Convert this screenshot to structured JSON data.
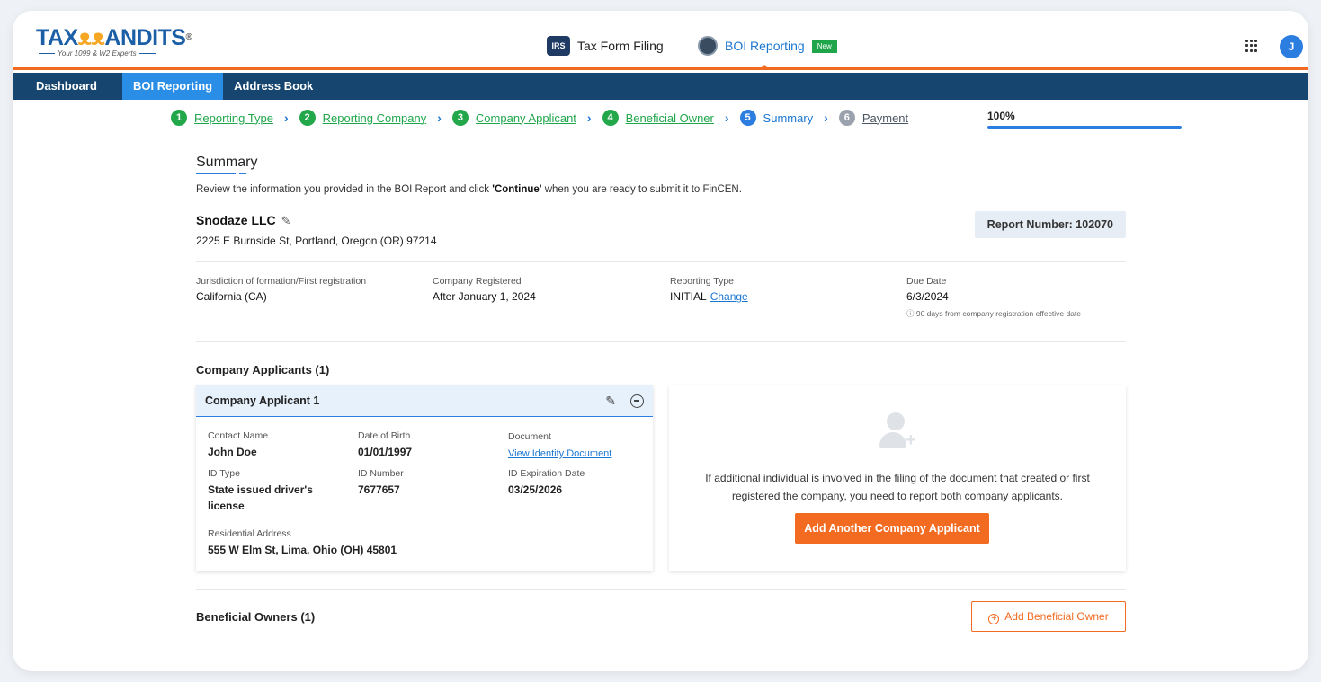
{
  "brand": {
    "name_part1": "TAX",
    "name_owl": "ᴥᴥ",
    "name_part2": "ANDITS",
    "registered": "®",
    "tagline": "Your 1099 & W2 Experts"
  },
  "header": {
    "tax_form_filing": "Tax Form Filing",
    "boi_reporting": "BOI Reporting",
    "new_badge": "New",
    "avatar_initial": "J"
  },
  "nav": {
    "items": [
      {
        "label": "Dashboard"
      },
      {
        "label": "BOI Reporting"
      },
      {
        "label": "Address Book"
      }
    ]
  },
  "stepper": {
    "steps": [
      {
        "num": "1",
        "label": "Reporting Type"
      },
      {
        "num": "2",
        "label": "Reporting Company"
      },
      {
        "num": "3",
        "label": "Company Applicant"
      },
      {
        "num": "4",
        "label": "Beneficial Owner"
      },
      {
        "num": "5",
        "label": "Summary"
      },
      {
        "num": "6",
        "label": "Payment"
      }
    ],
    "progress_label": "100%",
    "progress_fraction": 1.0
  },
  "summary": {
    "title": "Summary",
    "review_prefix": "Review the information you provided in the BOI Report and click ",
    "review_bold": "'Continue'",
    "review_suffix": " when you are ready to submit it to FinCEN."
  },
  "company": {
    "name": "Snodaze LLC",
    "address": "2225 E Burnside St, Portland, Oregon (OR) 97214",
    "report_number": "Report Number: 102070"
  },
  "meta": {
    "jurisdiction_label": "Jurisdiction of formation/First registration",
    "jurisdiction_value": "California (CA)",
    "registered_label": "Company Registered",
    "registered_value": "After January 1, 2024",
    "reporting_type_label": "Reporting Type",
    "reporting_type_value": "INITIAL",
    "change_link": "Change",
    "due_label": "Due Date",
    "due_value": "6/3/2024",
    "due_note": "ⓘ 90 days from company registration effective date"
  },
  "applicants": {
    "section_title": "Company Applicants (1)",
    "card_title": "Company Applicant 1",
    "contact_name_label": "Contact Name",
    "contact_name": "John Doe",
    "dob_label": "Date of Birth",
    "dob": "01/01/1997",
    "document_label": "Document",
    "document_link": "View Identity Document",
    "id_type_label": "ID Type",
    "id_type": "State issued driver's license",
    "id_number_label": "ID Number",
    "id_number": "7677657",
    "id_exp_label": "ID Expiration Date",
    "id_exp": "03/25/2026",
    "address_label": "Residential Address",
    "address": "555 W Elm St, Lima, Ohio (OH) 45801"
  },
  "add_applicant": {
    "text": "If additional individual is involved in the filing of the document that created or first registered the company, you need to report both company applicants.",
    "button": "Add Another Company Applicant"
  },
  "owners": {
    "section_title": "Beneficial Owners (1)",
    "add_button": "Add Beneficial Owner"
  }
}
